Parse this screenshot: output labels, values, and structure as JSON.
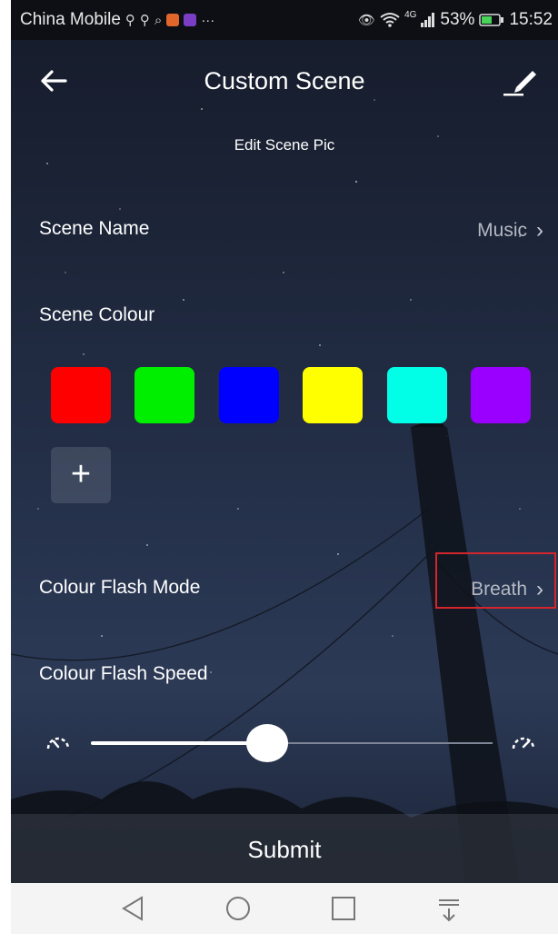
{
  "status_bar": {
    "carrier": "China Mobile",
    "left_icons": [
      "usb-icon",
      "usb-icon",
      "search-icon",
      "app-icon",
      "app-icon",
      "more-icon"
    ],
    "right_icons": [
      "eye-icon",
      "wifi-icon",
      "signal-icon",
      "battery-icon"
    ],
    "network": "4G",
    "battery": "53%",
    "time": "15:52"
  },
  "header": {
    "title": "Custom Scene",
    "back_icon": "arrow-left-icon",
    "edit_icon": "pencil-icon"
  },
  "edit_scene_pic": "Edit Scene Pic",
  "scene_name": {
    "label": "Scene Name",
    "value": "Music"
  },
  "scene_colour": {
    "label": "Scene Colour",
    "colors": [
      "#ff0000",
      "#00ee00",
      "#0000ff",
      "#ffff00",
      "#00ffe6",
      "#9900ff"
    ],
    "add_label": "+"
  },
  "flash_mode": {
    "label": "Colour Flash Mode",
    "value": "Breath"
  },
  "flash_speed": {
    "label": "Colour Flash Speed",
    "level": 0.44
  },
  "submit_label": "Submit",
  "nav": [
    "back-triangle-icon",
    "home-circle-icon",
    "recents-square-icon",
    "notification-pulldown-icon"
  ]
}
